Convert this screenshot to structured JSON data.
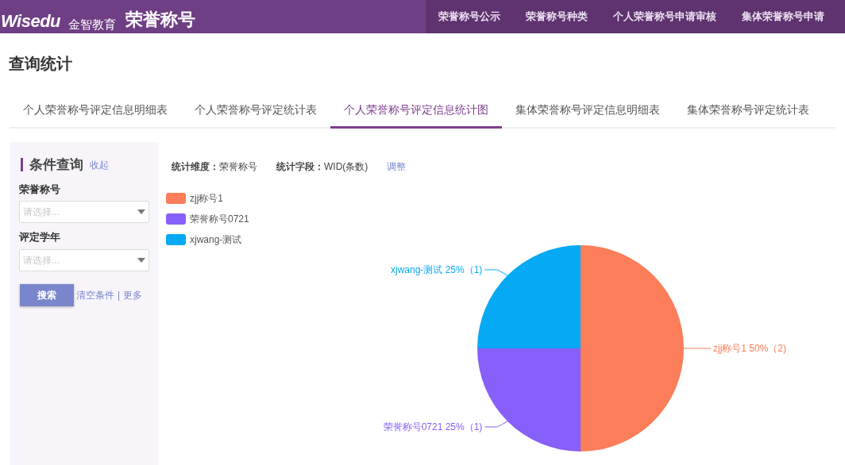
{
  "header": {
    "logo": "Wisedu",
    "logo_cn": "金智教育",
    "app_title": "荣誉称号",
    "nav": [
      {
        "label": "荣誉称号公示"
      },
      {
        "label": "荣誉称号种类"
      },
      {
        "label": "个人荣誉称号申请审核"
      },
      {
        "label": "集体荣誉称号申请"
      }
    ]
  },
  "page_title": "查询统计",
  "tabs": [
    {
      "label": "个人荣誉称号评定信息明细表",
      "selected": false
    },
    {
      "label": "个人荣誉称号评定统计表",
      "selected": false
    },
    {
      "label": "个人荣誉称号评定信息统计图",
      "selected": true
    },
    {
      "label": "集体荣誉称号评定信息明细表",
      "selected": false
    },
    {
      "label": "集体荣誉称号评定统计表",
      "selected": false
    }
  ],
  "sidebar": {
    "title": "条件查询",
    "collapse_link": "收起",
    "fields": [
      {
        "label": "荣誉称号",
        "placeholder": "请选择..."
      },
      {
        "label": "评定学年",
        "placeholder": "请选择..."
      }
    ],
    "search_button": "搜索",
    "clear_link": "清空条件",
    "separator": "|",
    "more_link": "更多"
  },
  "stats_header": {
    "dimension_label": "统计维度：",
    "dimension_value": "荣誉称号",
    "field_label": "统计字段：",
    "field_value": "WID(条数)",
    "adjust_link": "调整"
  },
  "legend": [
    {
      "color": "#fc7d5a"
    },
    {
      "color": "#875ff9"
    },
    {
      "color": "#05a9f4"
    }
  ],
  "chart_data": {
    "type": "pie",
    "categories": [
      "zjj称号1",
      "荣誉称号0721",
      "xjwang-测试"
    ],
    "values": [
      2,
      1,
      1
    ],
    "value_labels": [
      "50%（2)",
      "25%（1)",
      "25%（1)"
    ]
  }
}
